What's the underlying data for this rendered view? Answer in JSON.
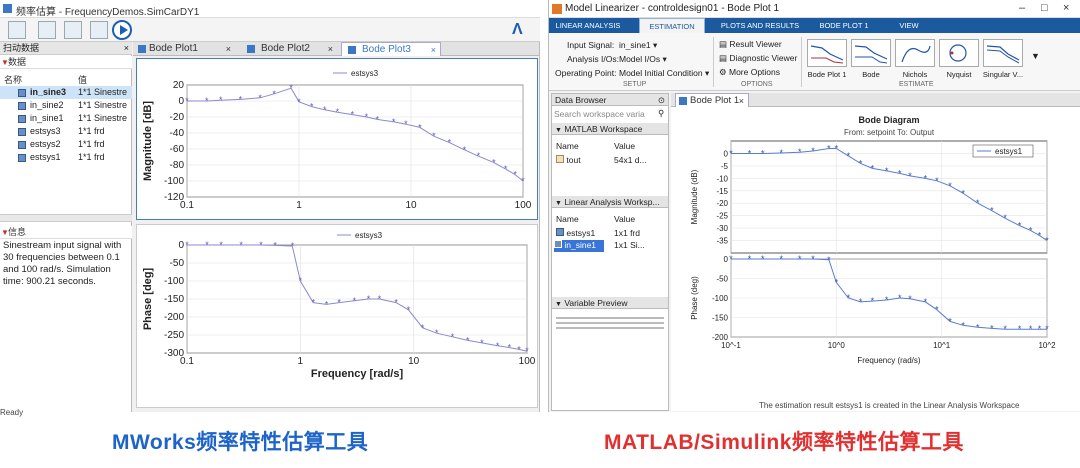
{
  "left_app": {
    "title": "频率估算 - FrequencyDemos.SimCarDY1",
    "panel": {
      "header": "扫动数据",
      "data_section": "数据",
      "columns": {
        "name": "名称",
        "value": "值"
      },
      "items": [
        {
          "name": "in_sine3",
          "value": "1*1 Sinestre"
        },
        {
          "name": "in_sine2",
          "value": "1*1 Sinestre"
        },
        {
          "name": "in_sine1",
          "value": "1*1 Sinestre"
        },
        {
          "name": "estsys3",
          "value": "1*1 frd"
        },
        {
          "name": "estsys2",
          "value": "1*1 frd"
        },
        {
          "name": "estsys1",
          "value": "1*1 frd"
        }
      ],
      "info_section": "信息",
      "info_text": "Sinestream input signal with 30 frequencies between 0.1 and 100 rad/s. Simulation time: 900.21 seconds."
    },
    "tabs": [
      {
        "label": "Bode Plot1"
      },
      {
        "label": "Bode Plot2"
      },
      {
        "label": "Bode Plot3"
      }
    ],
    "status": "Ready"
  },
  "right_app": {
    "title": "Model Linearizer - controldesign01 - Bode Plot 1",
    "ribbon_tabs": [
      "LINEAR ANALYSIS",
      "ESTIMATION",
      "PLOTS AND RESULTS",
      "BODE PLOT 1",
      "VIEW"
    ],
    "ribbon": {
      "input_signal_label": "Input Signal:",
      "input_signal_value": "in_sine1",
      "analysis_io_label": "Analysis I/Os:",
      "analysis_io_value": "Model I/Os",
      "operating_point_label": "Operating Point:",
      "operating_point_value": "Model Initial Condition",
      "setup_section": "SETUP",
      "result_viewer": "Result Viewer",
      "diagnostic_viewer": "Diagnostic Viewer",
      "more_options": "More Options",
      "options_section": "OPTIONS",
      "plot_buttons": [
        "Bode Plot 1",
        "Bode",
        "Nichols",
        "Nyquist",
        "Singular V..."
      ],
      "estimate_section": "ESTIMATE"
    },
    "data_browser": {
      "header": "Data Browser",
      "search_placeholder": "Search workspace varia",
      "matlab_workspace": "MATLAB Workspace",
      "columns": {
        "name": "Name",
        "value": "Value"
      },
      "matlab_items": [
        {
          "name": "tout",
          "value": "54x1 d..."
        }
      ],
      "linear_workspace": "Linear Analysis Worksp...",
      "linear_items": [
        {
          "name": "estsys1",
          "value": "1x1 frd"
        },
        {
          "name": "in_sine1",
          "value": "1x1 Si..."
        }
      ],
      "preview_header": "Variable Preview"
    },
    "plot_tab": "Bode Plot 1",
    "status": "The estimation result estsys1 is created in the Linear Analysis Workspace"
  },
  "captions": {
    "left": "MWorks频率特性估算工具",
    "right": "MATLAB/Simulink频率特性估算工具"
  },
  "chart_data": [
    {
      "type": "line",
      "title": "",
      "legend": [
        "estsys3"
      ],
      "xlabel": "",
      "ylabel": "Magnitude [dB]",
      "xscale": "log",
      "xlim": [
        0.1,
        100
      ],
      "ylim": [
        -120,
        20
      ],
      "xticks": [
        "0.1",
        "1",
        "10",
        "100"
      ],
      "yticks": [
        "20",
        "0",
        "-20",
        "-40",
        "-60",
        "-80",
        "-100",
        "-120"
      ],
      "x": [
        0.1,
        0.15,
        0.2,
        0.3,
        0.45,
        0.6,
        0.85,
        1.0,
        1.3,
        1.7,
        2.2,
        3.0,
        4.0,
        5.0,
        7.0,
        9.0,
        12,
        16,
        22,
        30,
        40,
        55,
        70,
        85,
        100
      ],
      "values": [
        0,
        0,
        1,
        2,
        4,
        9,
        16,
        -1,
        -7,
        -11,
        -14,
        -17,
        -20,
        -23,
        -26,
        -29,
        -33,
        -44,
        -52,
        -61,
        -69,
        -77,
        -85,
        -92,
        -100
      ]
    },
    {
      "type": "line",
      "title": "",
      "legend": [
        "estsys3"
      ],
      "xlabel": "Frequency [rad/s]",
      "ylabel": "Phase [deg]",
      "xscale": "log",
      "xlim": [
        0.1,
        100
      ],
      "ylim": [
        -300,
        0
      ],
      "xticks": [
        "0.1",
        "1",
        "10",
        "100"
      ],
      "yticks": [
        "0",
        "-50",
        "-100",
        "-150",
        "-200",
        "-250",
        "-300"
      ],
      "x": [
        0.1,
        0.15,
        0.2,
        0.3,
        0.45,
        0.6,
        0.85,
        1.0,
        1.3,
        1.7,
        2.2,
        3.0,
        4.0,
        5.0,
        7.0,
        9.0,
        12,
        16,
        22,
        30,
        40,
        55,
        70,
        85,
        100
      ],
      "values": [
        0,
        0,
        0,
        0,
        0,
        -1,
        -3,
        -100,
        -160,
        -165,
        -160,
        -155,
        -150,
        -150,
        -160,
        -180,
        -230,
        -245,
        -255,
        -265,
        -272,
        -280,
        -285,
        -290,
        -295
      ]
    },
    {
      "type": "line",
      "title": "Bode Diagram",
      "subtitle": "From: setpoint  To: Output",
      "legend": [
        "estsys1"
      ],
      "xlabel": "Frequency (rad/s)",
      "ylabel": "Magnitude (dB)",
      "xscale": "log",
      "xlim": [
        0.1,
        100
      ],
      "ylim": [
        -40,
        5
      ],
      "xticks": [
        "10^-1",
        "10^0",
        "10^1",
        "10^2"
      ],
      "yticks": [
        "0",
        "-5",
        "-10",
        "-15",
        "-20",
        "-25",
        "-30",
        "-35"
      ],
      "x": [
        0.1,
        0.15,
        0.2,
        0.3,
        0.45,
        0.6,
        0.85,
        1.0,
        1.3,
        1.7,
        2.2,
        3.0,
        4.0,
        5.0,
        7.0,
        9.0,
        12,
        16,
        22,
        30,
        40,
        55,
        70,
        85,
        100
      ],
      "values": [
        0,
        0,
        0,
        0.2,
        0.5,
        1,
        2,
        2,
        -1,
        -4,
        -6,
        -7,
        -8,
        -9,
        -10,
        -11,
        -13,
        -16,
        -20,
        -23,
        -26,
        -29,
        -31,
        -33,
        -35
      ]
    },
    {
      "type": "line",
      "title": "",
      "legend": [],
      "xlabel": "",
      "ylabel": "Phase (deg)",
      "xscale": "log",
      "xlim": [
        0.1,
        100
      ],
      "ylim": [
        -200,
        0
      ],
      "xticks": [
        "10^-1",
        "10^0",
        "10^1",
        "10^2"
      ],
      "yticks": [
        "0",
        "-50",
        "-100",
        "-150",
        "-200"
      ],
      "x": [
        0.1,
        0.15,
        0.2,
        0.3,
        0.45,
        0.6,
        0.85,
        1.0,
        1.3,
        1.7,
        2.2,
        3.0,
        4.0,
        5.0,
        7.0,
        9.0,
        12,
        16,
        22,
        30,
        40,
        55,
        70,
        85,
        100
      ],
      "values": [
        0,
        0,
        0,
        0,
        0,
        0,
        -2,
        -60,
        -100,
        -110,
        -108,
        -105,
        -100,
        -102,
        -110,
        -130,
        -160,
        -170,
        -175,
        -178,
        -180,
        -180,
        -180,
        -180,
        -180
      ]
    }
  ]
}
